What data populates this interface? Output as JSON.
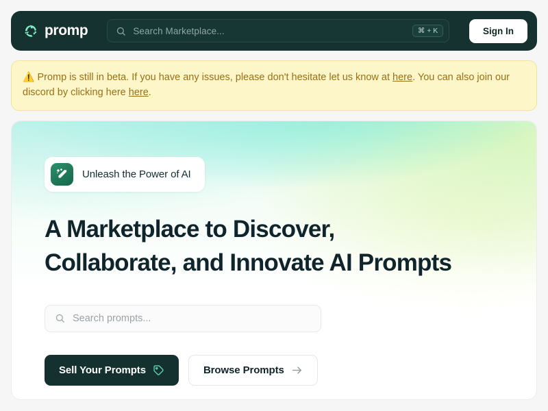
{
  "navbar": {
    "brand_name": "promp",
    "logo_icon": "recycle-arrows-icon",
    "search": {
      "placeholder": "Search Marketplace...",
      "icon": "search-icon",
      "shortcut": "⌘ + K"
    },
    "signin_label": "Sign In"
  },
  "banner": {
    "warning_icon": "⚠️",
    "text_part1": "Promp is still in beta. If you have any issues, please don't hesitate let us know at ",
    "link1": "here",
    "text_part2": ". You can also join our discord by clicking here ",
    "link2": "here",
    "text_part3": "."
  },
  "hero": {
    "badge": {
      "icon": "magic-wand-icon",
      "label": "Unleash the Power of AI"
    },
    "headline_line1": "A Marketplace to Discover,",
    "headline_line2": "Collaborate, and Innovate AI Prompts",
    "search": {
      "placeholder": "Search prompts...",
      "icon": "search-icon"
    },
    "primary_cta": {
      "label": "Sell Your Prompts",
      "icon": "tag-icon"
    },
    "secondary_cta": {
      "label": "Browse Prompts",
      "icon": "arrow-right-icon"
    }
  },
  "colors": {
    "navbar_bg": "#153130",
    "page_bg": "#f6f6f6",
    "banner_bg": "#fcf6c9",
    "banner_text": "#9a6f15",
    "accent_mint": "#7ff0c8",
    "dark_teal": "#14302f",
    "hero_gradient_start": "#aaeee4",
    "hero_gradient_mid": "#56e6cf",
    "hero_gradient_end": "#ffffff"
  }
}
